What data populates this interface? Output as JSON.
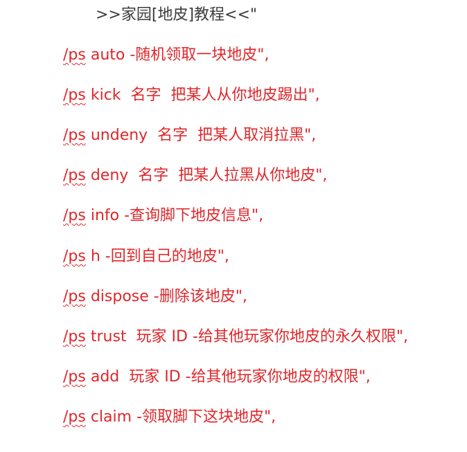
{
  "title": ">>家园[地皮]教程<<\"",
  "commands": [
    {
      "prefix": "/ps",
      "text": " auto -随机领取一块地皮\","
    },
    {
      "prefix": "/ps",
      "text": " kick  名字  把某人从你地皮踢出\","
    },
    {
      "prefix": "/ps",
      "text": " undeny  名字  把某人取消拉黑\","
    },
    {
      "prefix": "/ps",
      "text": " deny  名字  把某人拉黑从你地皮\","
    },
    {
      "prefix": "/ps",
      "text": " info -查询脚下地皮信息\","
    },
    {
      "prefix": "/ps",
      "text": " h -回到自己的地皮\","
    },
    {
      "prefix": "/ps",
      "text": " dispose -删除该地皮\","
    },
    {
      "prefix": "/ps",
      "text": " trust  玩家 ID -给其他玩家你地皮的永久权限\","
    },
    {
      "prefix": "/ps",
      "text": " add  玩家 ID -给其他玩家你地皮的权限\","
    },
    {
      "prefix": "/ps",
      "text": " claim -领取脚下这块地皮\","
    }
  ],
  "colors": {
    "title": "#3a3a3a",
    "command": "#e0262a",
    "background": "#ffffff"
  }
}
